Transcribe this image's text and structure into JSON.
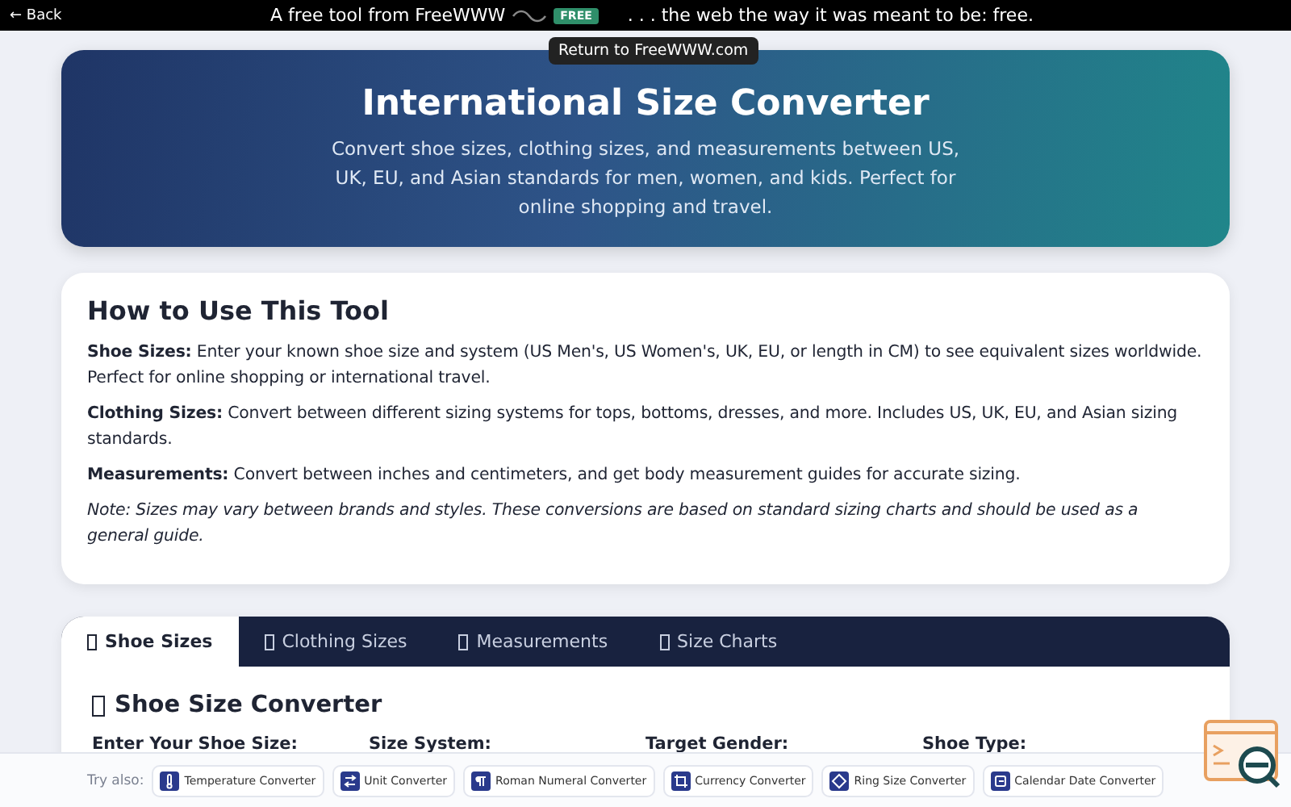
{
  "top_bar": {
    "back": "← Back",
    "promo_before": "A free tool from FreeWWW",
    "badge": "FREE",
    "promo_after": ". . . the web the way it was meant to be: free.",
    "tooltip": "Return to FreeWWW.com"
  },
  "hero": {
    "title": "International Size Converter",
    "subtitle": "Convert shoe sizes, clothing sizes, and measurements between US, UK, EU, and Asian standards for men, women, and kids. Perfect for online shopping and travel."
  },
  "how_to": {
    "title": "How to Use This Tool",
    "paragraphs": [
      {
        "kind": "text",
        "text": "**Shoe Sizes:** Enter your known shoe size and system (US Men's, US Women's, UK, EU, or length in CM) to see equivalent sizes worldwide. Perfect for online shopping or international travel."
      },
      {
        "kind": "text",
        "text": "**Clothing Sizes:** Convert between different sizing systems for tops, bottoms, dresses, and more. Includes US, UK, EU, and Asian sizing standards."
      },
      {
        "kind": "text",
        "text": "**Measurements:** Convert between inches and centimeters, and get body measurement guides for accurate sizing."
      },
      {
        "kind": "note",
        "text": "Note: Sizes may vary between brands and styles. These conversions are based on standard sizing charts and should be used as a general guide."
      }
    ]
  },
  "tabs": [
    {
      "label": "Shoe Sizes",
      "selected": true
    },
    {
      "label": "Clothing Sizes",
      "selected": false
    },
    {
      "label": "Measurements",
      "selected": false
    },
    {
      "label": "Size Charts",
      "selected": false
    }
  ],
  "converter": {
    "title": "Shoe Size Converter",
    "fields": [
      "Enter Your Shoe Size:",
      "Size System:",
      "Target Gender:",
      "Shoe Type:"
    ]
  },
  "footer": {
    "label": "Try also:",
    "links": [
      {
        "label": "Temperature Converter",
        "kind": "thermometer"
      },
      {
        "label": "Unit Converter",
        "kind": "arrows"
      },
      {
        "label": "Roman Numeral Converter",
        "kind": "pilcrow"
      },
      {
        "label": "Currency Converter",
        "kind": "frame"
      },
      {
        "label": "Ring Size Converter",
        "kind": "diamond"
      },
      {
        "label": "Calendar Date Converter",
        "kind": "calendar"
      }
    ]
  }
}
